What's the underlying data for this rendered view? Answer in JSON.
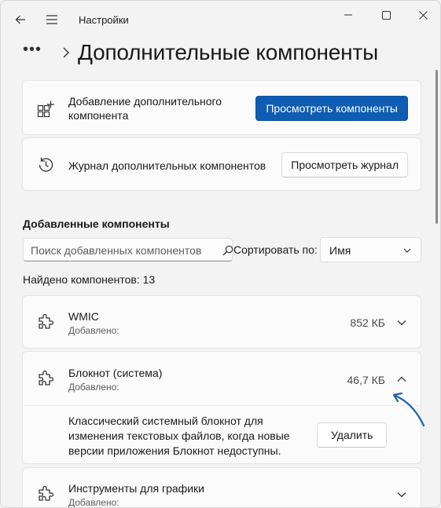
{
  "titlebar": {
    "title": "Настройки",
    "back_icon": "arrow-left-icon",
    "menu_icon": "hamburger-icon",
    "minimize_icon": "minimize-icon",
    "maximize_icon": "maximize-icon",
    "close_icon": "close-icon"
  },
  "breadcrumb": {
    "overflow": "•••",
    "title": "Дополнительные компоненты"
  },
  "actions": {
    "add": {
      "label": "Добавление дополнительного компонента",
      "button": "Просмотреть компоненты",
      "icon": "add-grid-icon"
    },
    "history": {
      "label": "Журнал дополнительных компонентов",
      "button": "Просмотреть журнал",
      "icon": "history-icon"
    }
  },
  "installed": {
    "heading": "Добавленные компоненты",
    "search_placeholder": "Поиск добавленных компонентов",
    "sort_label": "Сортировать по:",
    "sort_value": "Имя",
    "found": "Найдено компонентов: 13",
    "items": [
      {
        "name": "WMIC",
        "added": "Добавлено:",
        "size": "852 КБ",
        "expanded": false
      },
      {
        "name": "Блокнот (система)",
        "added": "Добавлено:",
        "size": "46,7 КБ",
        "expanded": true,
        "description": "Классический системный блокнот для изменения текстовых файлов, когда новые версии приложения Блокнот недоступны.",
        "remove_label": "Удалить"
      },
      {
        "name": "Инструменты для графики",
        "added": "Добавлено:",
        "size": "",
        "expanded": false
      }
    ]
  },
  "colors": {
    "accent": "#0f5cb3",
    "annotation_arrow": "#1f5fa8",
    "background": "#f3f3f3",
    "card": "#fbfbfb"
  }
}
